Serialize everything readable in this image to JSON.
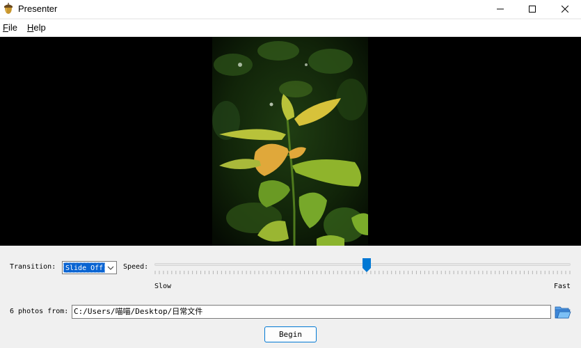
{
  "window": {
    "title": "Presenter",
    "app_icon": "acorn-icon",
    "controls": [
      "minimize-icon",
      "maximize-icon",
      "close-icon"
    ]
  },
  "menu": {
    "file": {
      "accel": "F",
      "rest": "ile"
    },
    "help": {
      "accel": "H",
      "rest": "elp"
    }
  },
  "display": {
    "background": "#000000",
    "photo_description": "green and yellow leaves on dark foliage"
  },
  "controls": {
    "transition_label": "Transition:",
    "transition_value": "Slide Off",
    "speed_label": "Speed:",
    "speed_min_label": "Slow",
    "speed_max_label": "Fast",
    "speed_value": 0.51,
    "photos_label": "6 photos from:",
    "path_value": "C:/Users/喵喵/Desktop/日常文件",
    "browse_icon": "folder-open-icon",
    "begin_label": "Begin"
  },
  "colors": {
    "accent": "#0078d4",
    "selection": "#0a64d2"
  }
}
